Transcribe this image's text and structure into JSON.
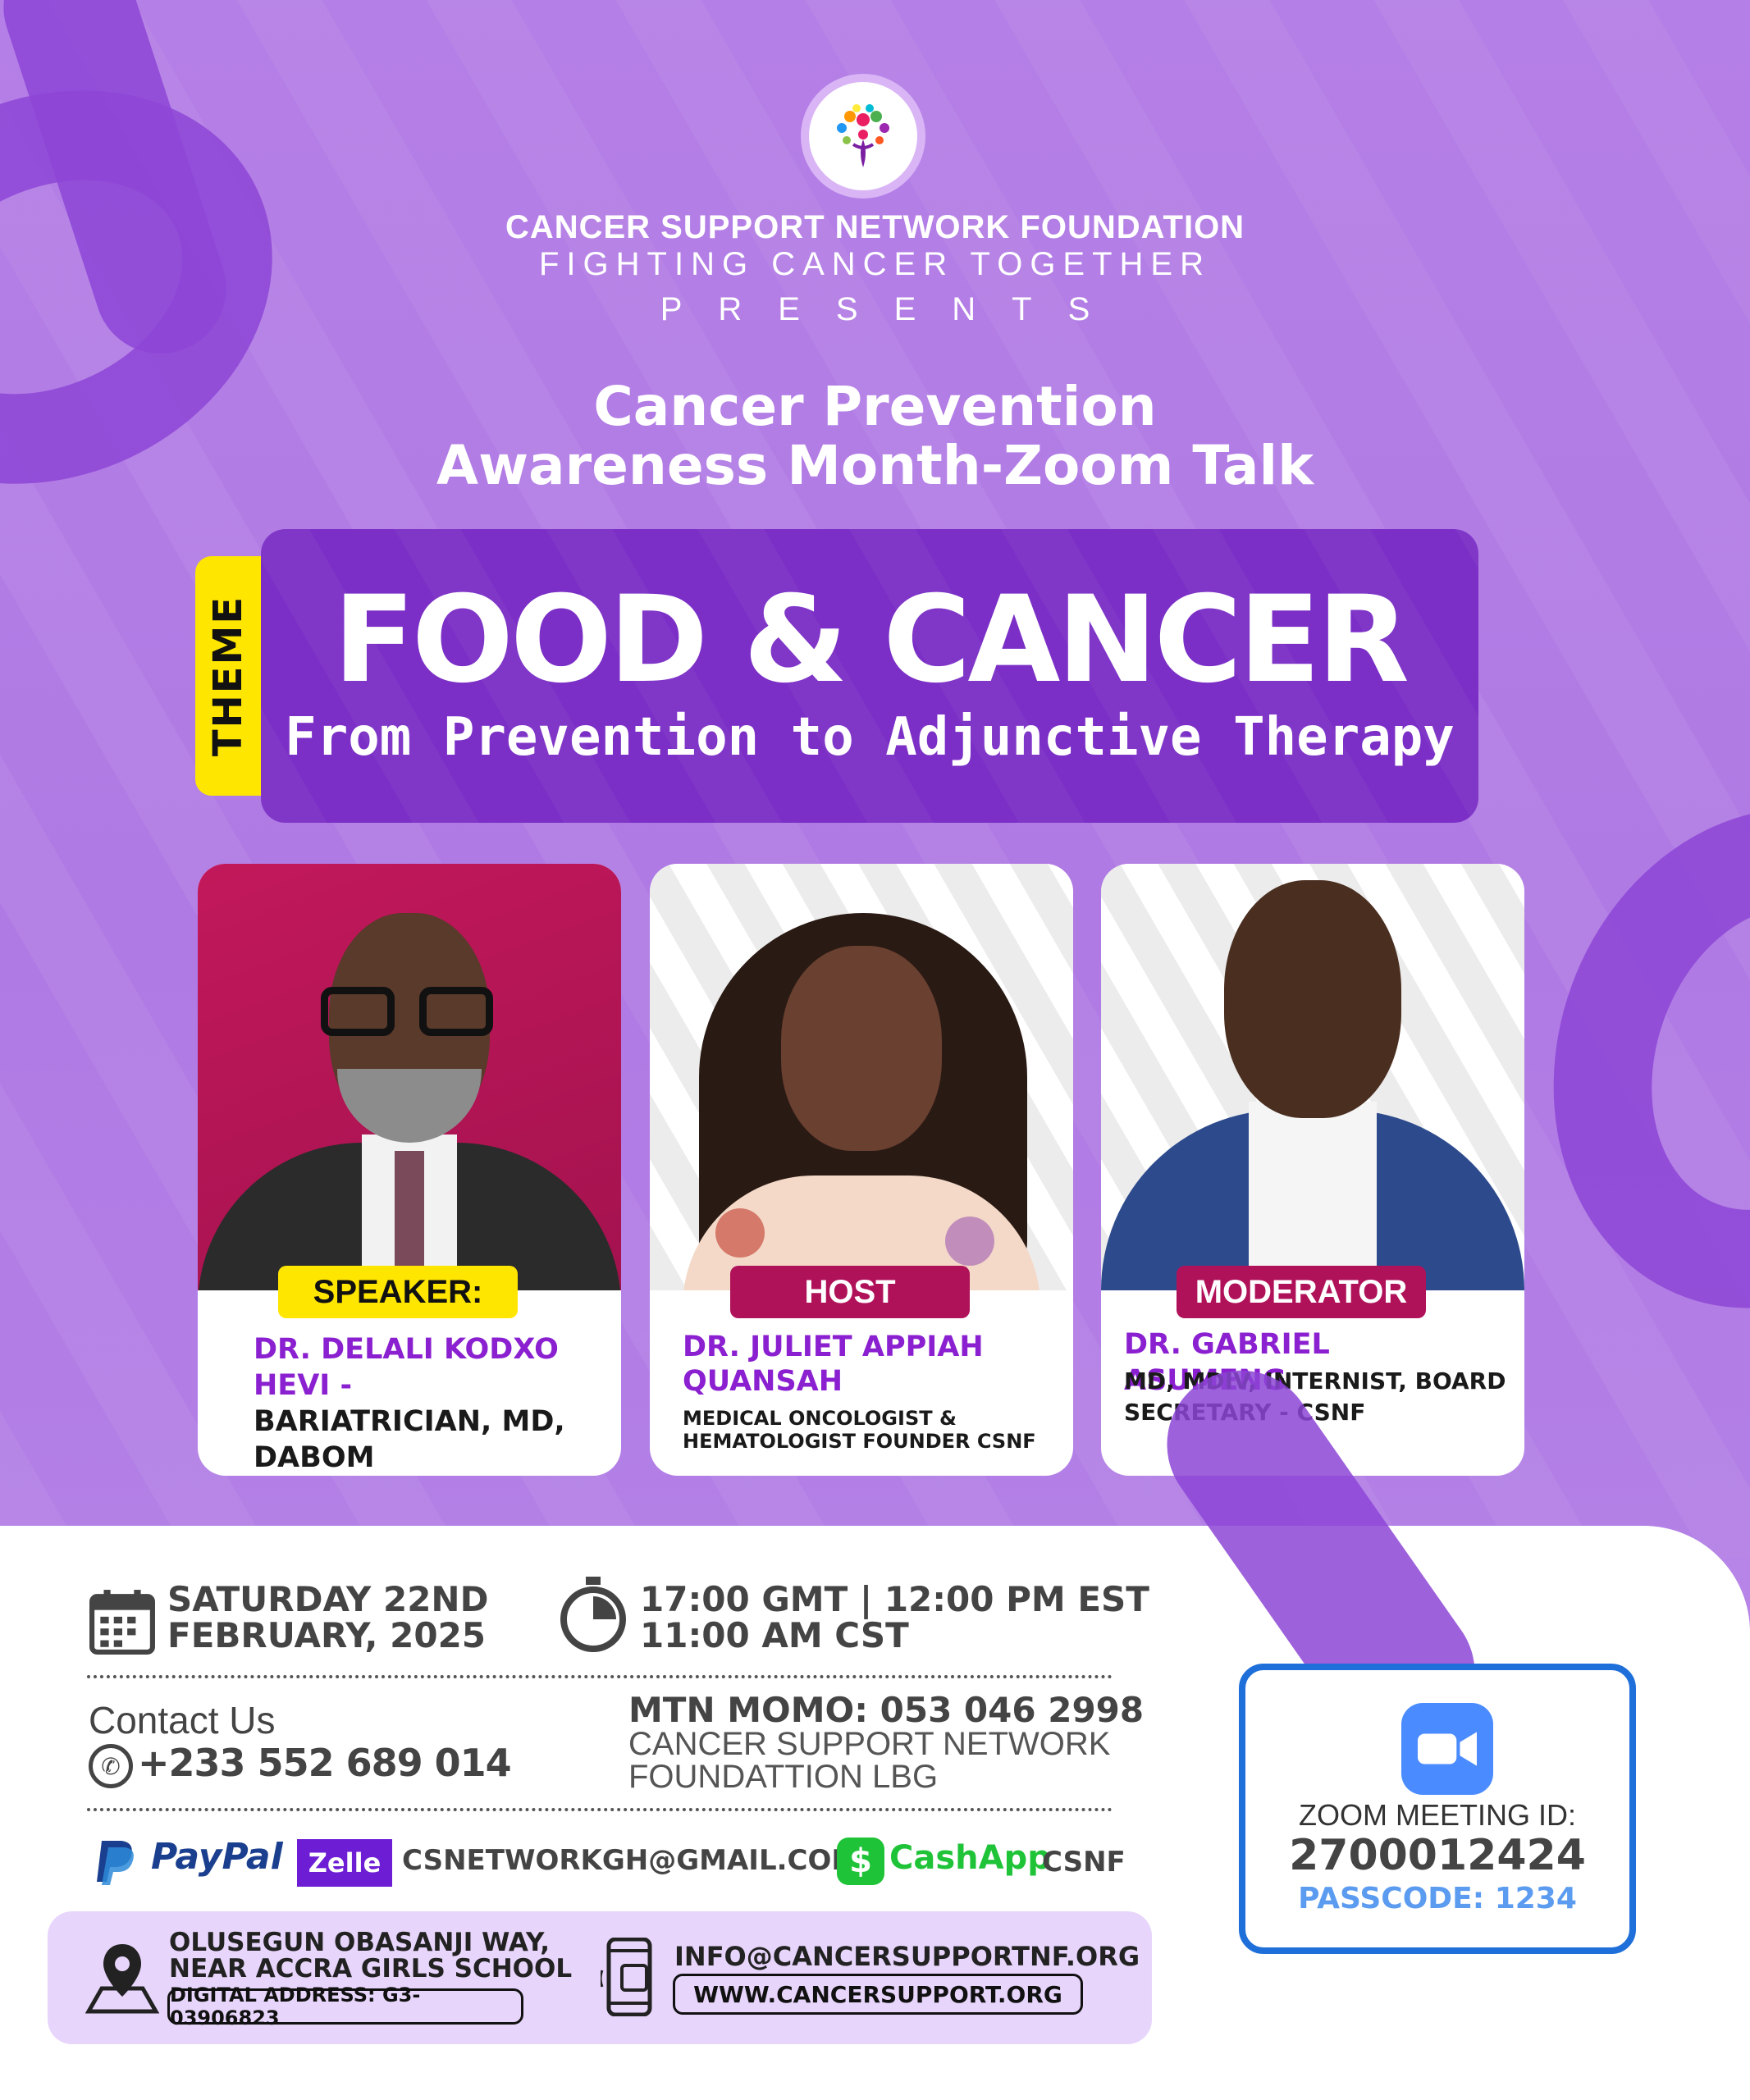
{
  "header": {
    "org_name": "CANCER SUPPORT NETWORK FOUNDATION",
    "tagline": "FIGHTING CANCER TOGETHER",
    "presents": "PRESENTS"
  },
  "event": {
    "title_line1": "Cancer Prevention",
    "title_line2": "Awareness Month-Zoom Talk"
  },
  "theme": {
    "tag": "THEME",
    "main": "FOOD & CANCER",
    "subtitle": "From Prevention to Adjunctive Therapy"
  },
  "people": [
    {
      "role": "SPEAKER:",
      "name": "DR. DELALI KODXO HEVI -",
      "desc": "BARIATRICIAN, MD, DABOM"
    },
    {
      "role": "HOST",
      "name": "DR. JULIET APPIAH QUANSAH",
      "desc": "MEDICAL ONCOLOGIST & HEMATOLOGIST FOUNDER CSNF"
    },
    {
      "role": "MODERATOR",
      "name": "DR. GABRIEL ASUMENG",
      "desc": "MD, MDIV, INTERNIST, BOARD SECRETARY - CSNF"
    }
  ],
  "details": {
    "date_line1": "SATURDAY 22ND",
    "date_line2": "FEBRUARY, 2025",
    "time_line1": "17:00 GMT | 12:00 PM EST",
    "time_line2": "11:00 AM CST",
    "contact_label": "Contact Us",
    "phone": "+233 552 689 014",
    "momo": "MTN MOMO: 053 046 2998",
    "momo_name_line1": "CANCER SUPPORT NETWORK",
    "momo_name_line2": "FOUNDATTION LBG",
    "paypal": "PayPal",
    "zelle": "Zelle",
    "email": "CSNETWORKGH@GMAIL.COM",
    "cashapp": "CashApp",
    "cashapp_tag": "CSNF"
  },
  "zoom": {
    "label": "ZOOM MEETING ID:",
    "id": "2700012424",
    "passcode": "PASSCODE: 1234"
  },
  "footer": {
    "address_line1": "OLUSEGUN OBASANJI WAY,",
    "address_line2": "NEAR ACCRA GIRLS SCHOOL",
    "digital_address": "DIGITAL ADDRESS: G3-03906823",
    "info_email": "INFO@CANCERSUPPORTNF.ORG",
    "website": "WWW.CANCERSUPPORT.ORG"
  },
  "colors": {
    "background": "#b784e8",
    "theme_box": "#7b2fc6",
    "accent_purple": "#8a20d0",
    "badge_yellow": "#ffe600",
    "badge_magenta": "#b0125a",
    "zoom_blue": "#1e6fd9"
  },
  "icons": [
    "logo-tree-icon",
    "calendar-icon",
    "stopwatch-icon",
    "phone-icon",
    "paypal-icon",
    "zelle-icon",
    "cashapp-icon",
    "zoom-camera-icon",
    "map-pin-icon",
    "mobile-phone-icon"
  ]
}
